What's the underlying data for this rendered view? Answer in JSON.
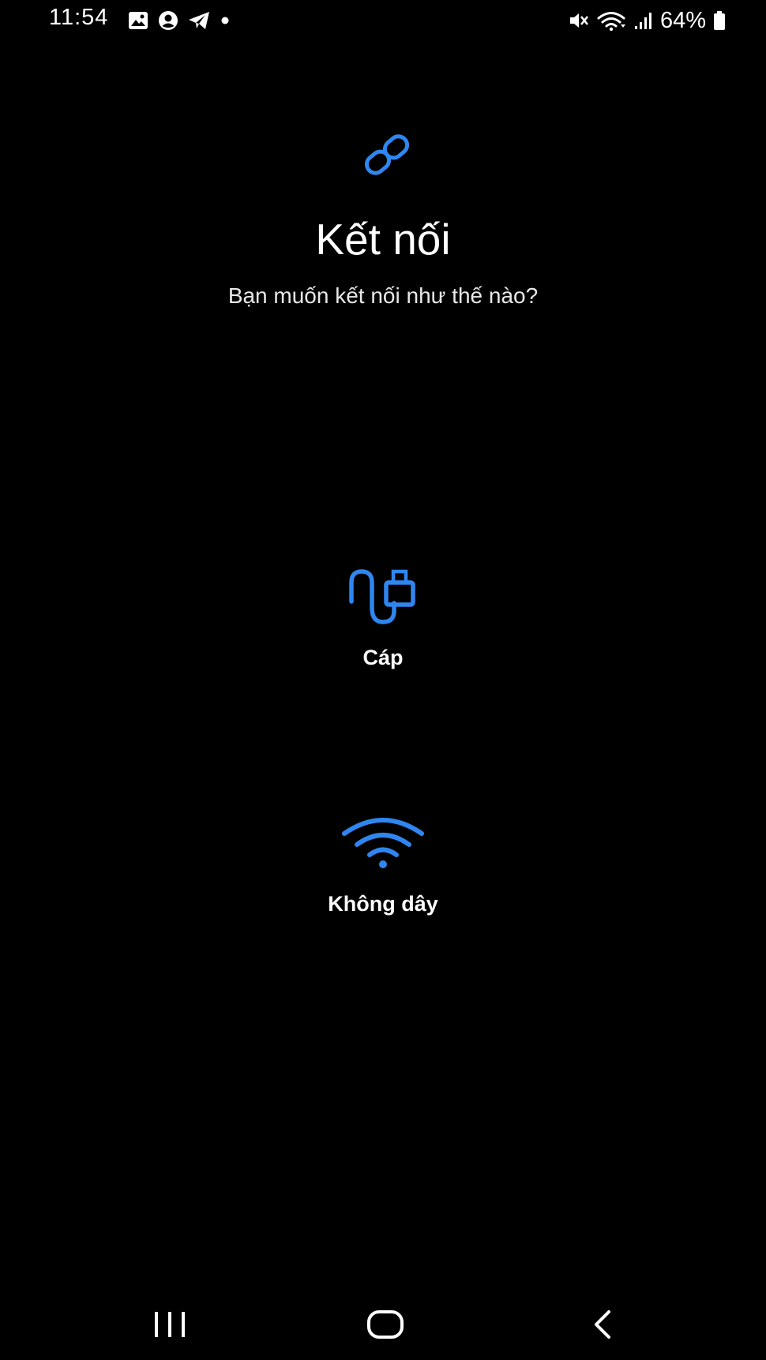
{
  "status_bar": {
    "time": "11:54",
    "battery_percent": "64%",
    "left_icons": [
      "gallery-icon",
      "account-icon",
      "telegram-icon",
      "notification-dot-icon"
    ],
    "right_icons": [
      "mute-icon",
      "wifi-icon",
      "signal-icon",
      "battery-icon"
    ]
  },
  "header": {
    "icon": "link-icon",
    "title": "Kết nối",
    "subtitle": "Bạn muốn kết nối như thế nào?"
  },
  "options": [
    {
      "id": "cable",
      "label": "Cáp",
      "icon": "usb-cable-icon"
    },
    {
      "id": "wireless",
      "label": "Không dây",
      "icon": "wifi-icon"
    }
  ],
  "nav_bar": {
    "buttons": [
      "recents-icon",
      "home-icon",
      "back-icon"
    ]
  },
  "colors": {
    "background": "#000000",
    "accent": "#2f86f0",
    "text": "#ffffff"
  }
}
